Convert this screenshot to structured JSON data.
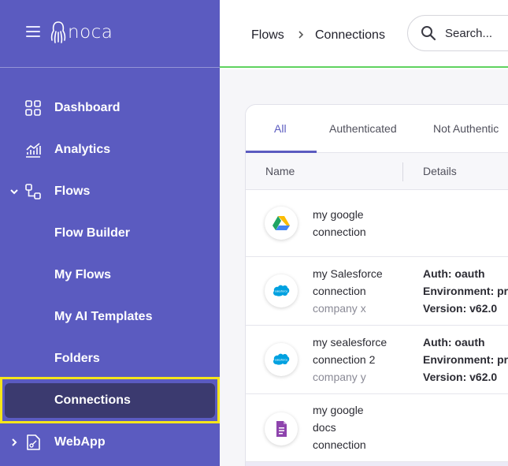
{
  "app": {
    "logo_text": "noca"
  },
  "sidebar": {
    "items": [
      {
        "label": "Dashboard"
      },
      {
        "label": "Analytics"
      },
      {
        "label": "Flows"
      },
      {
        "label": "Flow Builder"
      },
      {
        "label": "My Flows"
      },
      {
        "label": "My AI Templates"
      },
      {
        "label": "Folders"
      },
      {
        "label": "Connections"
      },
      {
        "label": "WebApp"
      }
    ]
  },
  "header": {
    "breadcrumb": [
      "Flows",
      "Connections"
    ],
    "search_placeholder": "Search..."
  },
  "tabs": [
    "All",
    "Authenticated",
    "Not Authentic"
  ],
  "table": {
    "columns": [
      "Name",
      "Details"
    ],
    "rows": [
      {
        "icon": "google-drive-icon",
        "name": "my google connection",
        "name_lines": [
          "my google",
          "connection"
        ],
        "company": "",
        "details": []
      },
      {
        "icon": "salesforce-icon",
        "name": "my Salesforce connection",
        "name_lines": [
          "my Salesforce",
          "connection"
        ],
        "company": "company x",
        "details": [
          "Auth: oauth",
          "Environment: pr",
          "Version: v62.0"
        ]
      },
      {
        "icon": "salesforce-icon",
        "name": "my sealesforce connection 2",
        "name_lines": [
          "my sealesforce",
          "connection 2"
        ],
        "company": "company y",
        "details": [
          "Auth: oauth",
          "Environment: pr",
          "Version: v62.0"
        ]
      },
      {
        "icon": "google-docs-icon",
        "name": "my google docs connection",
        "name_lines": [
          "my google",
          "docs",
          "connection"
        ],
        "company": "",
        "details": []
      }
    ]
  },
  "colors": {
    "sidebar": "#5b5bc0",
    "active_item": "#3b3a6f",
    "highlight": "#f5e51b",
    "accent": "#5b5bc0",
    "header_line": "#5fd35f"
  }
}
